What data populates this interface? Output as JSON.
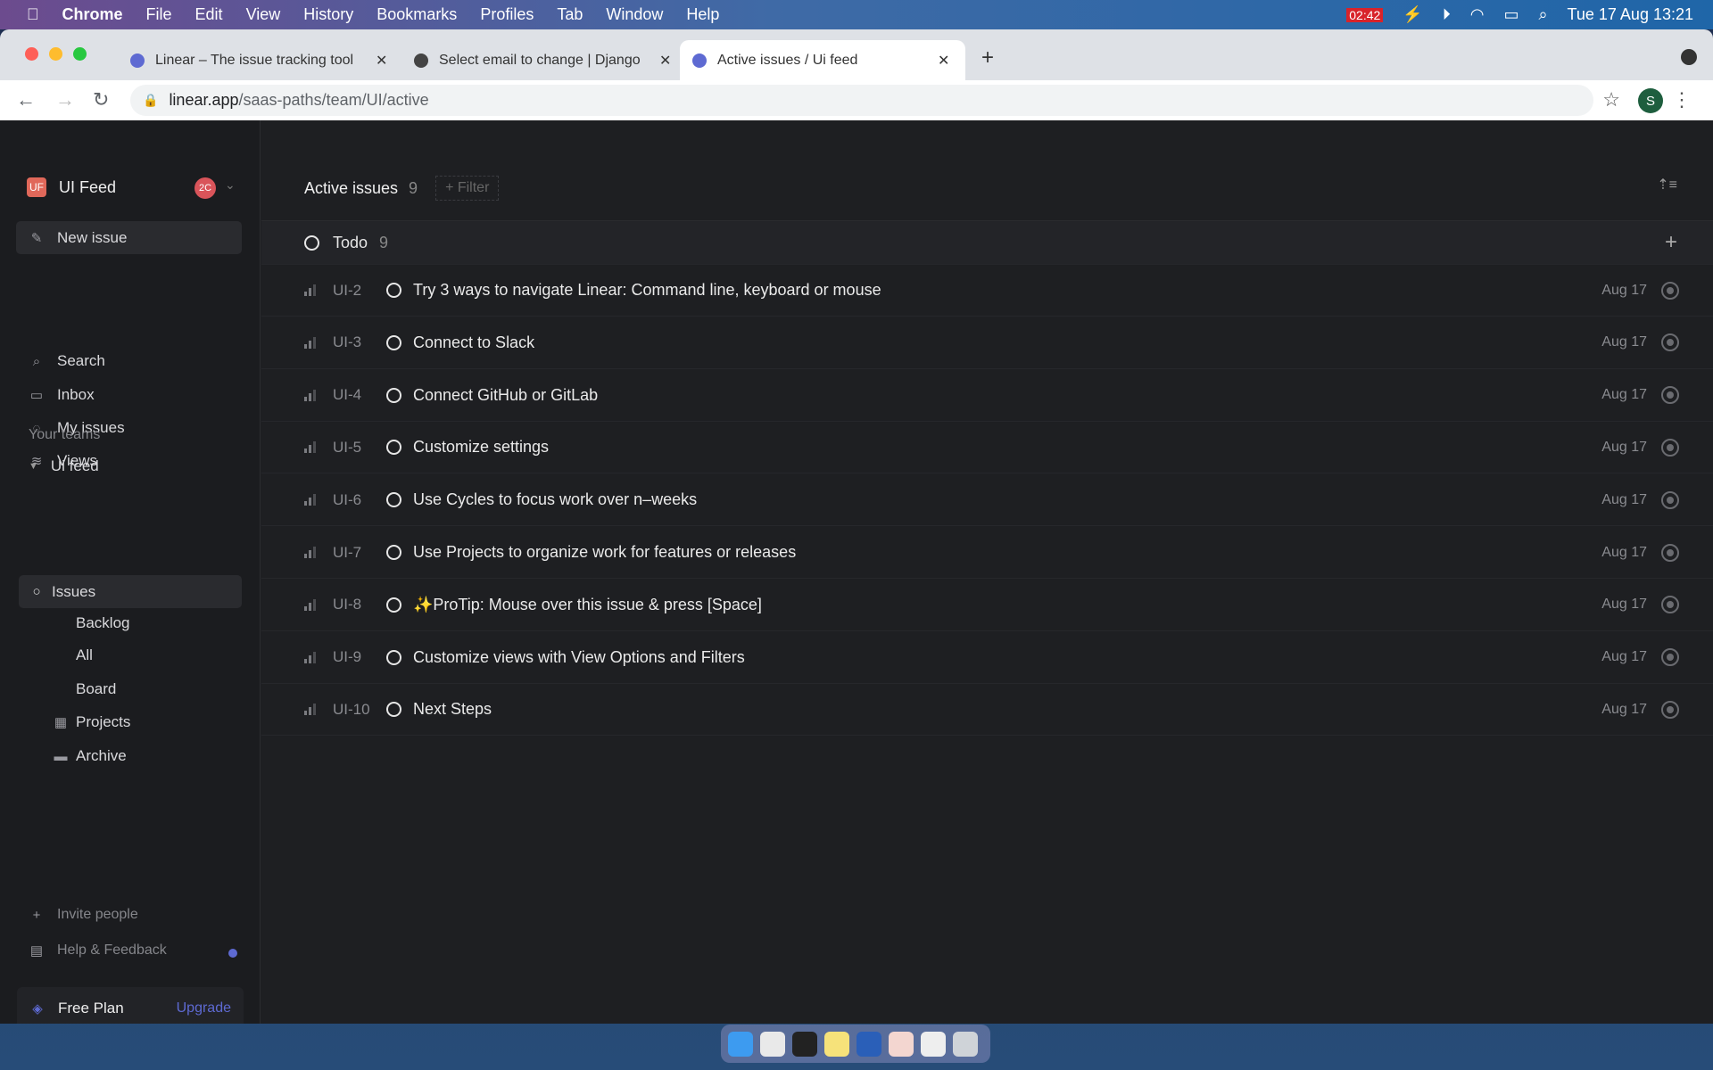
{
  "menubar": {
    "app": "Chrome",
    "items": [
      "File",
      "Edit",
      "View",
      "History",
      "Bookmarks",
      "Profiles",
      "Tab",
      "Window",
      "Help"
    ],
    "recording": "02:42",
    "datetime": "Tue 17 Aug  13:21"
  },
  "browser": {
    "tabs": [
      {
        "title": "Linear – The issue tracking tool"
      },
      {
        "title": "Select email to change | Django"
      },
      {
        "title": "Active issues / Ui feed"
      }
    ],
    "url_host": "linear.app",
    "url_path": "/saas-paths/team/UI/active",
    "profile": "S"
  },
  "sidebar": {
    "workspace_badge": "UF",
    "workspace": "UI Feed",
    "user_badge": "2C",
    "new_issue": "New issue",
    "nav": [
      "Search",
      "Inbox",
      "My issues",
      "Views"
    ],
    "teams_label": "Your teams",
    "team": "Ui feed",
    "team_items": [
      "Issues",
      "Backlog",
      "All",
      "Board",
      "Projects",
      "Archive"
    ],
    "invite": "Invite people",
    "help": "Help & Feedback",
    "plan": "Free Plan",
    "upgrade": "Upgrade",
    "accent": "#5e6ad2"
  },
  "main": {
    "title": "Active issues",
    "count": "9",
    "filter": "+ Filter",
    "group": {
      "name": "Todo",
      "count": "9"
    },
    "issues": [
      {
        "id": "UI-2",
        "title": "Try 3 ways to navigate Linear: Command line, keyboard or mouse",
        "date": "Aug 17"
      },
      {
        "id": "UI-3",
        "title": "Connect to Slack",
        "date": "Aug 17"
      },
      {
        "id": "UI-4",
        "title": "Connect GitHub or GitLab",
        "date": "Aug 17"
      },
      {
        "id": "UI-5",
        "title": "Customize settings",
        "date": "Aug 17"
      },
      {
        "id": "UI-6",
        "title": "Use Cycles to focus work over n–weeks",
        "date": "Aug 17"
      },
      {
        "id": "UI-7",
        "title": "Use Projects to organize work for features or releases",
        "date": "Aug 17"
      },
      {
        "id": "UI-8",
        "title": "✨ProTip: Mouse over this issue & press [Space]",
        "date": "Aug 17"
      },
      {
        "id": "UI-9",
        "title": "Customize views with View Options and Filters",
        "date": "Aug 17"
      },
      {
        "id": "UI-10",
        "title": "Next Steps",
        "date": "Aug 17"
      }
    ]
  },
  "dock": [
    "finder",
    "chrome",
    "terminal",
    "notes",
    "reeder",
    "folder",
    "screenshot",
    "trash"
  ]
}
